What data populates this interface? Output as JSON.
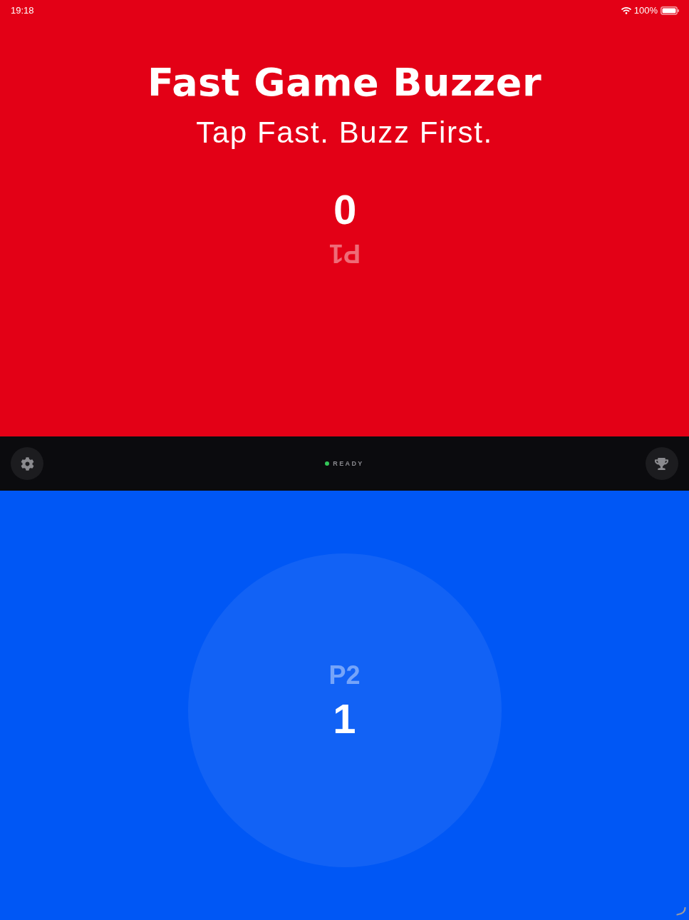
{
  "status_bar": {
    "time": "19:18",
    "battery": "100%"
  },
  "header": {
    "title": "Fast Game Buzzer",
    "subtitle": "Tap Fast. Buzz First."
  },
  "players": [
    {
      "label": "P1",
      "score": "0",
      "color": "#e30016",
      "upside_down": true,
      "highlighted": false
    },
    {
      "label": "P2",
      "score": "1",
      "color": "#0057f5",
      "upside_down": false,
      "highlighted": true
    }
  ],
  "control_bar": {
    "status": "READY"
  }
}
